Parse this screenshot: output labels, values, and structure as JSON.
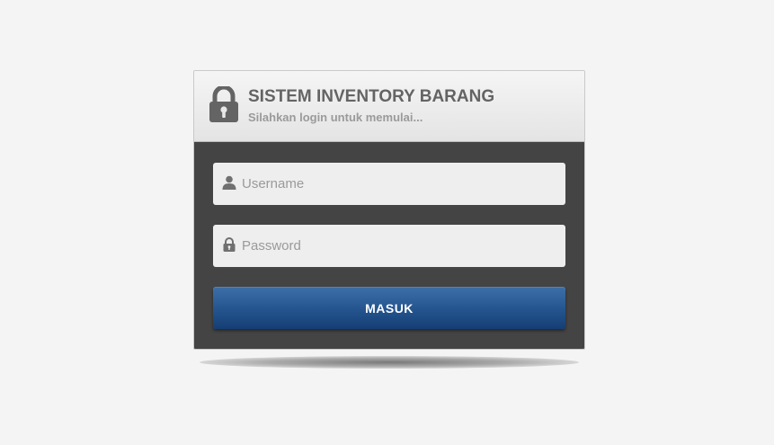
{
  "header": {
    "title": "SISTEM INVENTORY BARANG",
    "subtitle": "Silahkan login untuk memulai...",
    "icon": "lock-icon"
  },
  "form": {
    "username": {
      "placeholder": "Username",
      "value": "",
      "icon": "user-icon"
    },
    "password": {
      "placeholder": "Password",
      "value": "",
      "icon": "lock-icon"
    },
    "submit_label": "MASUK"
  },
  "colors": {
    "page_background": "#f4f4f4",
    "header_background": "#e8e8e8",
    "body_background": "#444444",
    "input_background": "#eeeeee",
    "button_background": "#24548e",
    "title_text": "#646464",
    "subtitle_text": "#9a9a9a"
  }
}
